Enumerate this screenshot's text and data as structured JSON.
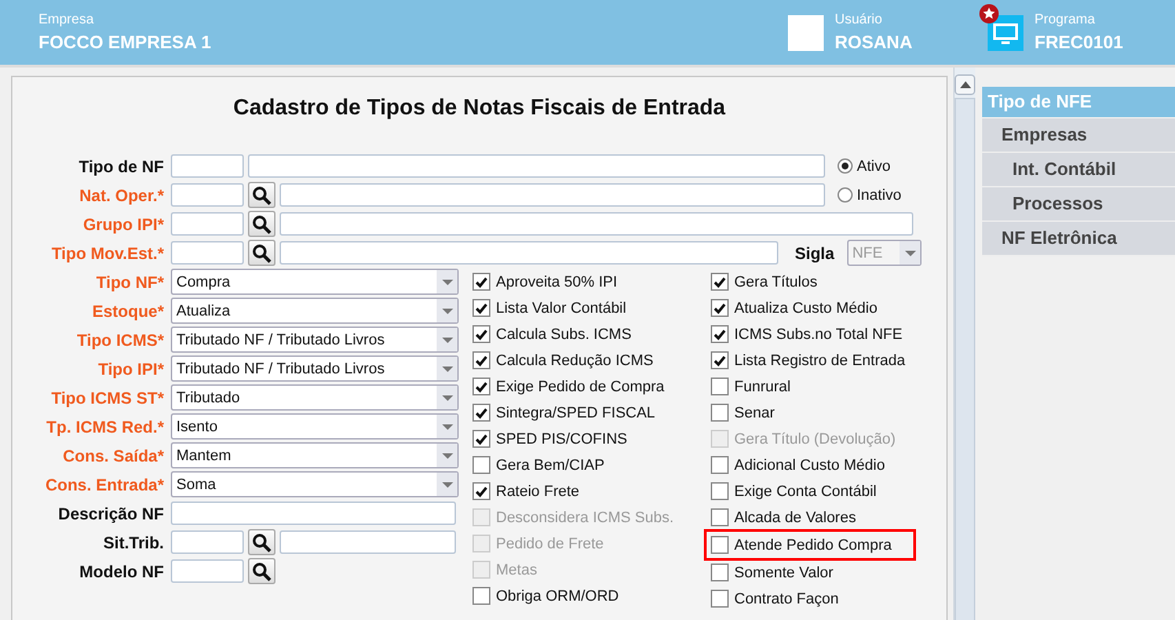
{
  "header": {
    "company": {
      "label": "Empresa",
      "value": "FOCCO EMPRESA 1"
    },
    "user": {
      "label": "Usuário",
      "value": "ROSANA"
    },
    "program": {
      "label": "Programa",
      "value": "FREC0101"
    }
  },
  "title": "Cadastro de Tipos de Notas Fiscais de Entrada",
  "top_rows": [
    {
      "label": "Tipo de NF",
      "required": false,
      "kind": "plain"
    },
    {
      "label": "Nat. Oper.*",
      "required": true,
      "kind": "lookup"
    },
    {
      "label": "Grupo IPI*",
      "required": true,
      "kind": "lookup-wide"
    },
    {
      "label": "Tipo Mov.Est.*",
      "required": true,
      "kind": "lookup-sigla"
    }
  ],
  "status": [
    {
      "label": "Ativo",
      "selected": true
    },
    {
      "label": "Inativo",
      "selected": false
    }
  ],
  "sigla": {
    "label": "Sigla",
    "value": "NFE",
    "disabled": true
  },
  "fields": [
    {
      "label": "Tipo NF*",
      "required": true,
      "kind": "select",
      "value": "Compra"
    },
    {
      "label": "Estoque*",
      "required": true,
      "kind": "select",
      "value": "Atualiza"
    },
    {
      "label": "Tipo ICMS*",
      "required": true,
      "kind": "select",
      "value": "Tributado NF / Tributado Livros"
    },
    {
      "label": "Tipo IPI*",
      "required": true,
      "kind": "select",
      "value": "Tributado NF / Tributado Livros"
    },
    {
      "label": "Tipo ICMS ST*",
      "required": true,
      "kind": "select",
      "value": "Tributado"
    },
    {
      "label": "Tp. ICMS Red.*",
      "required": true,
      "kind": "select",
      "value": "Isento"
    },
    {
      "label": "Cons. Saída*",
      "required": true,
      "kind": "select",
      "value": "Mantem"
    },
    {
      "label": "Cons. Entrada*",
      "required": true,
      "kind": "select",
      "value": "Soma"
    },
    {
      "label": "Descrição NF",
      "required": false,
      "kind": "text"
    },
    {
      "label": "Sit.Trib.",
      "required": false,
      "kind": "lookup"
    },
    {
      "label": "Modelo NF",
      "required": false,
      "kind": "lookup-short"
    }
  ],
  "options_left": [
    {
      "label": "Aproveita 50% IPI",
      "checked": true,
      "disabled": false
    },
    {
      "label": "Lista Valor Contábil",
      "checked": true,
      "disabled": false
    },
    {
      "label": "Calcula Subs. ICMS",
      "checked": true,
      "disabled": false
    },
    {
      "label": "Calcula Redução ICMS",
      "checked": true,
      "disabled": false
    },
    {
      "label": "Exige Pedido de Compra",
      "checked": true,
      "disabled": false
    },
    {
      "label": "Sintegra/SPED FISCAL",
      "checked": true,
      "disabled": false
    },
    {
      "label": "SPED PIS/COFINS",
      "checked": true,
      "disabled": false
    },
    {
      "label": "Gera Bem/CIAP",
      "checked": false,
      "disabled": false
    },
    {
      "label": "Rateio Frete",
      "checked": true,
      "disabled": false
    },
    {
      "label": "Desconsidera ICMS Subs.",
      "checked": false,
      "disabled": true
    },
    {
      "label": "Pedido de Frete",
      "checked": false,
      "disabled": true
    },
    {
      "label": "Metas",
      "checked": false,
      "disabled": true
    },
    {
      "label": "Obriga ORM/ORD",
      "checked": false,
      "disabled": false
    }
  ],
  "options_right": [
    {
      "label": "Gera Títulos",
      "checked": true,
      "disabled": false,
      "highlighted": false
    },
    {
      "label": "Atualiza Custo Médio",
      "checked": true,
      "disabled": false,
      "highlighted": false
    },
    {
      "label": "ICMS Subs.no Total NFE",
      "checked": true,
      "disabled": false,
      "highlighted": false
    },
    {
      "label": "Lista Registro de Entrada",
      "checked": true,
      "disabled": false,
      "highlighted": false
    },
    {
      "label": "Funrural",
      "checked": false,
      "disabled": false,
      "highlighted": false
    },
    {
      "label": "Senar",
      "checked": false,
      "disabled": false,
      "highlighted": false
    },
    {
      "label": "Gera Título (Devolução)",
      "checked": false,
      "disabled": true,
      "highlighted": false
    },
    {
      "label": "Adicional Custo Médio",
      "checked": false,
      "disabled": false,
      "highlighted": false
    },
    {
      "label": "Exige Conta Contábil",
      "checked": false,
      "disabled": false,
      "highlighted": false
    },
    {
      "label": "Alcada de Valores",
      "checked": false,
      "disabled": false,
      "highlighted": false
    },
    {
      "label": "Atende Pedido Compra",
      "checked": false,
      "disabled": false,
      "highlighted": true
    },
    {
      "label": "Somente Valor",
      "checked": false,
      "disabled": false,
      "highlighted": false
    },
    {
      "label": "Contrato Façon",
      "checked": false,
      "disabled": false,
      "highlighted": false
    }
  ],
  "sidebar": {
    "items": [
      {
        "label": "Tipo de NFE",
        "selected": true
      },
      {
        "label": "Empresas",
        "selected": false,
        "children": [
          {
            "label": "Int. Contábil",
            "selected": false
          },
          {
            "label": "Processos",
            "selected": false
          }
        ]
      },
      {
        "label": "NF Eletrônica",
        "selected": false
      }
    ]
  }
}
